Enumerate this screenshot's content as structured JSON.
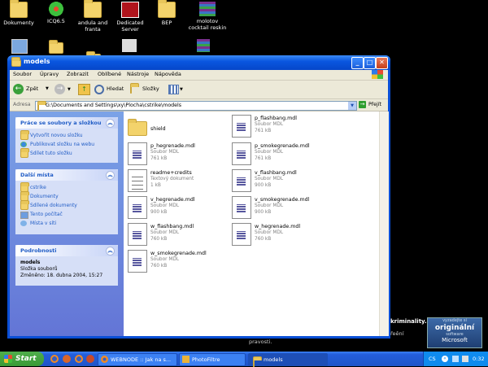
{
  "desktop": {
    "icons": [
      {
        "label": "Dokumenty",
        "icon": "documents-folder-icon"
      },
      {
        "label": "ICQ6.5",
        "icon": "icq-flower-icon"
      },
      {
        "label": "andula and franta",
        "icon": "folder-icon"
      },
      {
        "label": "Dedicated Server",
        "icon": "dedicated-server-icon"
      },
      {
        "label": "BEP",
        "icon": "folder-icon"
      },
      {
        "label": "molotov cocktail reskin",
        "icon": "winrar-archive-icon"
      }
    ],
    "bg_text": {
      "krim": "kriminality.",
      "prevzeti": "řeění",
      "pravosti": "pravosti."
    },
    "badge": {
      "line1": "vyzadejte si",
      "line2": "originální",
      "line3": "software",
      "line4": "Microsoft"
    }
  },
  "window": {
    "title": "models",
    "menu": [
      "Soubor",
      "Úpravy",
      "Zobrazit",
      "Oblíbené",
      "Nástroje",
      "Nápověda"
    ],
    "toolbar": {
      "back": "Zpět",
      "search": "Hledat",
      "folders": "Složky"
    },
    "address": {
      "label": "Adresa",
      "value": "G:\\Documents and Settings\\xy\\Plocha\\cstrike\\models",
      "go": "Přejít"
    },
    "tasks": {
      "file_tasks": {
        "title": "Práce se soubory a složkou",
        "links": [
          "Vytvořit novou složku",
          "Publikovat složku na webu",
          "Sdílet tuto složku"
        ]
      },
      "other_places": {
        "title": "Další místa",
        "links": [
          "cstrike",
          "Dokumenty",
          "Sdílené dokumenty",
          "Tento počítač",
          "Místa v síti"
        ]
      },
      "details": {
        "title": "Podrobnosti",
        "name": "models",
        "type": "Složka souborů",
        "modified": "Změněno: 18. dubna 2004, 15:27"
      }
    },
    "files": [
      {
        "name": "shield",
        "type": "",
        "size": "",
        "kind": "folder"
      },
      {
        "name": "p_flashbang.mdl",
        "type": "Soubor MDL",
        "size": "761 kB",
        "kind": "mdl"
      },
      {
        "name": "p_hegrenade.mdl",
        "type": "Soubor MDL",
        "size": "761 kB",
        "kind": "mdl"
      },
      {
        "name": "p_smokegrenade.mdl",
        "type": "Soubor MDL",
        "size": "761 kB",
        "kind": "mdl"
      },
      {
        "name": "readme+credits",
        "type": "Textový dokument",
        "size": "1 kB",
        "kind": "txt"
      },
      {
        "name": "v_flashbang.mdl",
        "type": "Soubor MDL",
        "size": "900 kB",
        "kind": "mdl"
      },
      {
        "name": "v_hegrenade.mdl",
        "type": "Soubor MDL",
        "size": "900 kB",
        "kind": "mdl"
      },
      {
        "name": "v_smokegrenade.mdl",
        "type": "Soubor MDL",
        "size": "900 kB",
        "kind": "mdl"
      },
      {
        "name": "w_flashbang.mdl",
        "type": "Soubor MDL",
        "size": "760 kB",
        "kind": "mdl"
      },
      {
        "name": "w_hegrenade.mdl",
        "type": "Soubor MDL",
        "size": "760 kB",
        "kind": "mdl"
      },
      {
        "name": "w_smokegrenade.mdl",
        "type": "Soubor MDL",
        "size": "760 kB",
        "kind": "mdl"
      }
    ]
  },
  "taskbar": {
    "start": "Start",
    "tasks": [
      "WEBNODE :: Jak na s...",
      "PhotoFiltre",
      "models"
    ],
    "lang": "CS",
    "clock": "0:32"
  },
  "colors": {
    "xp_blue": "#0a4fd6",
    "task_panel": "#6f8be0",
    "link": "#215dc6",
    "start_green": "#3a9a36"
  }
}
